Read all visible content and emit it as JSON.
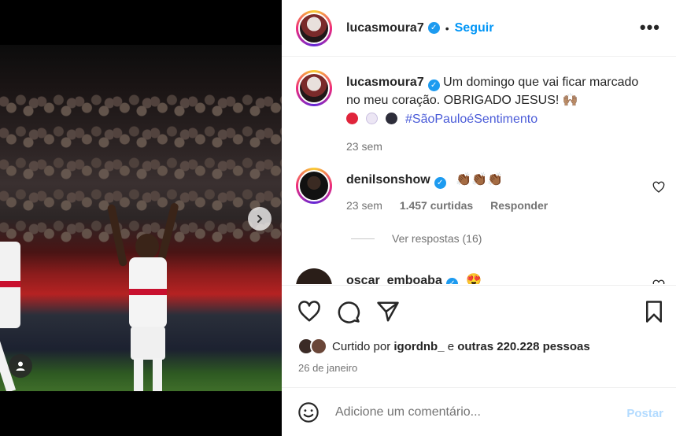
{
  "post": {
    "username": "lucasmoura7",
    "follow_label": "Seguir",
    "separator": "•",
    "more_label": "•••"
  },
  "caption": {
    "username": "lucasmoura7",
    "text": "Um domingo que vai ficar marcado no meu coração. OBRIGADO JESUS! 🙌🏽",
    "emojis_line": "🔴 ⚪ ⚫",
    "hashtag": "#SãoPauloéSentimento",
    "time": "23 sem"
  },
  "comments": [
    {
      "username": "denilsonshow",
      "text": "👏🏾👏🏾👏🏾",
      "time": "23 sem",
      "likes": "1.457 curtidas",
      "reply_label": "Responder",
      "view_replies": "Ver respostas (16)"
    },
    {
      "username": "oscar_emboaba",
      "text": "😍"
    }
  ],
  "likes": {
    "prefix": "Curtido por ",
    "user": "igordnb_",
    "connector": " e ",
    "others": "outras 220.228 pessoas"
  },
  "date": "26 de janeiro",
  "comment_box": {
    "placeholder": "Adicione um comentário...",
    "post_label": "Postar"
  },
  "colors": {
    "accent": "#0095f6",
    "verified": "#1d9bf0",
    "hashtag": "#4a5bd8"
  },
  "icons": {
    "header_more": "more-horizontal-icon",
    "like": "heart-outline-icon",
    "comment": "comment-bubble-icon",
    "share": "paper-plane-icon",
    "save": "bookmark-icon",
    "emoji": "smiley-icon",
    "next": "chevron-right-icon",
    "tags": "user-tag-icon"
  }
}
